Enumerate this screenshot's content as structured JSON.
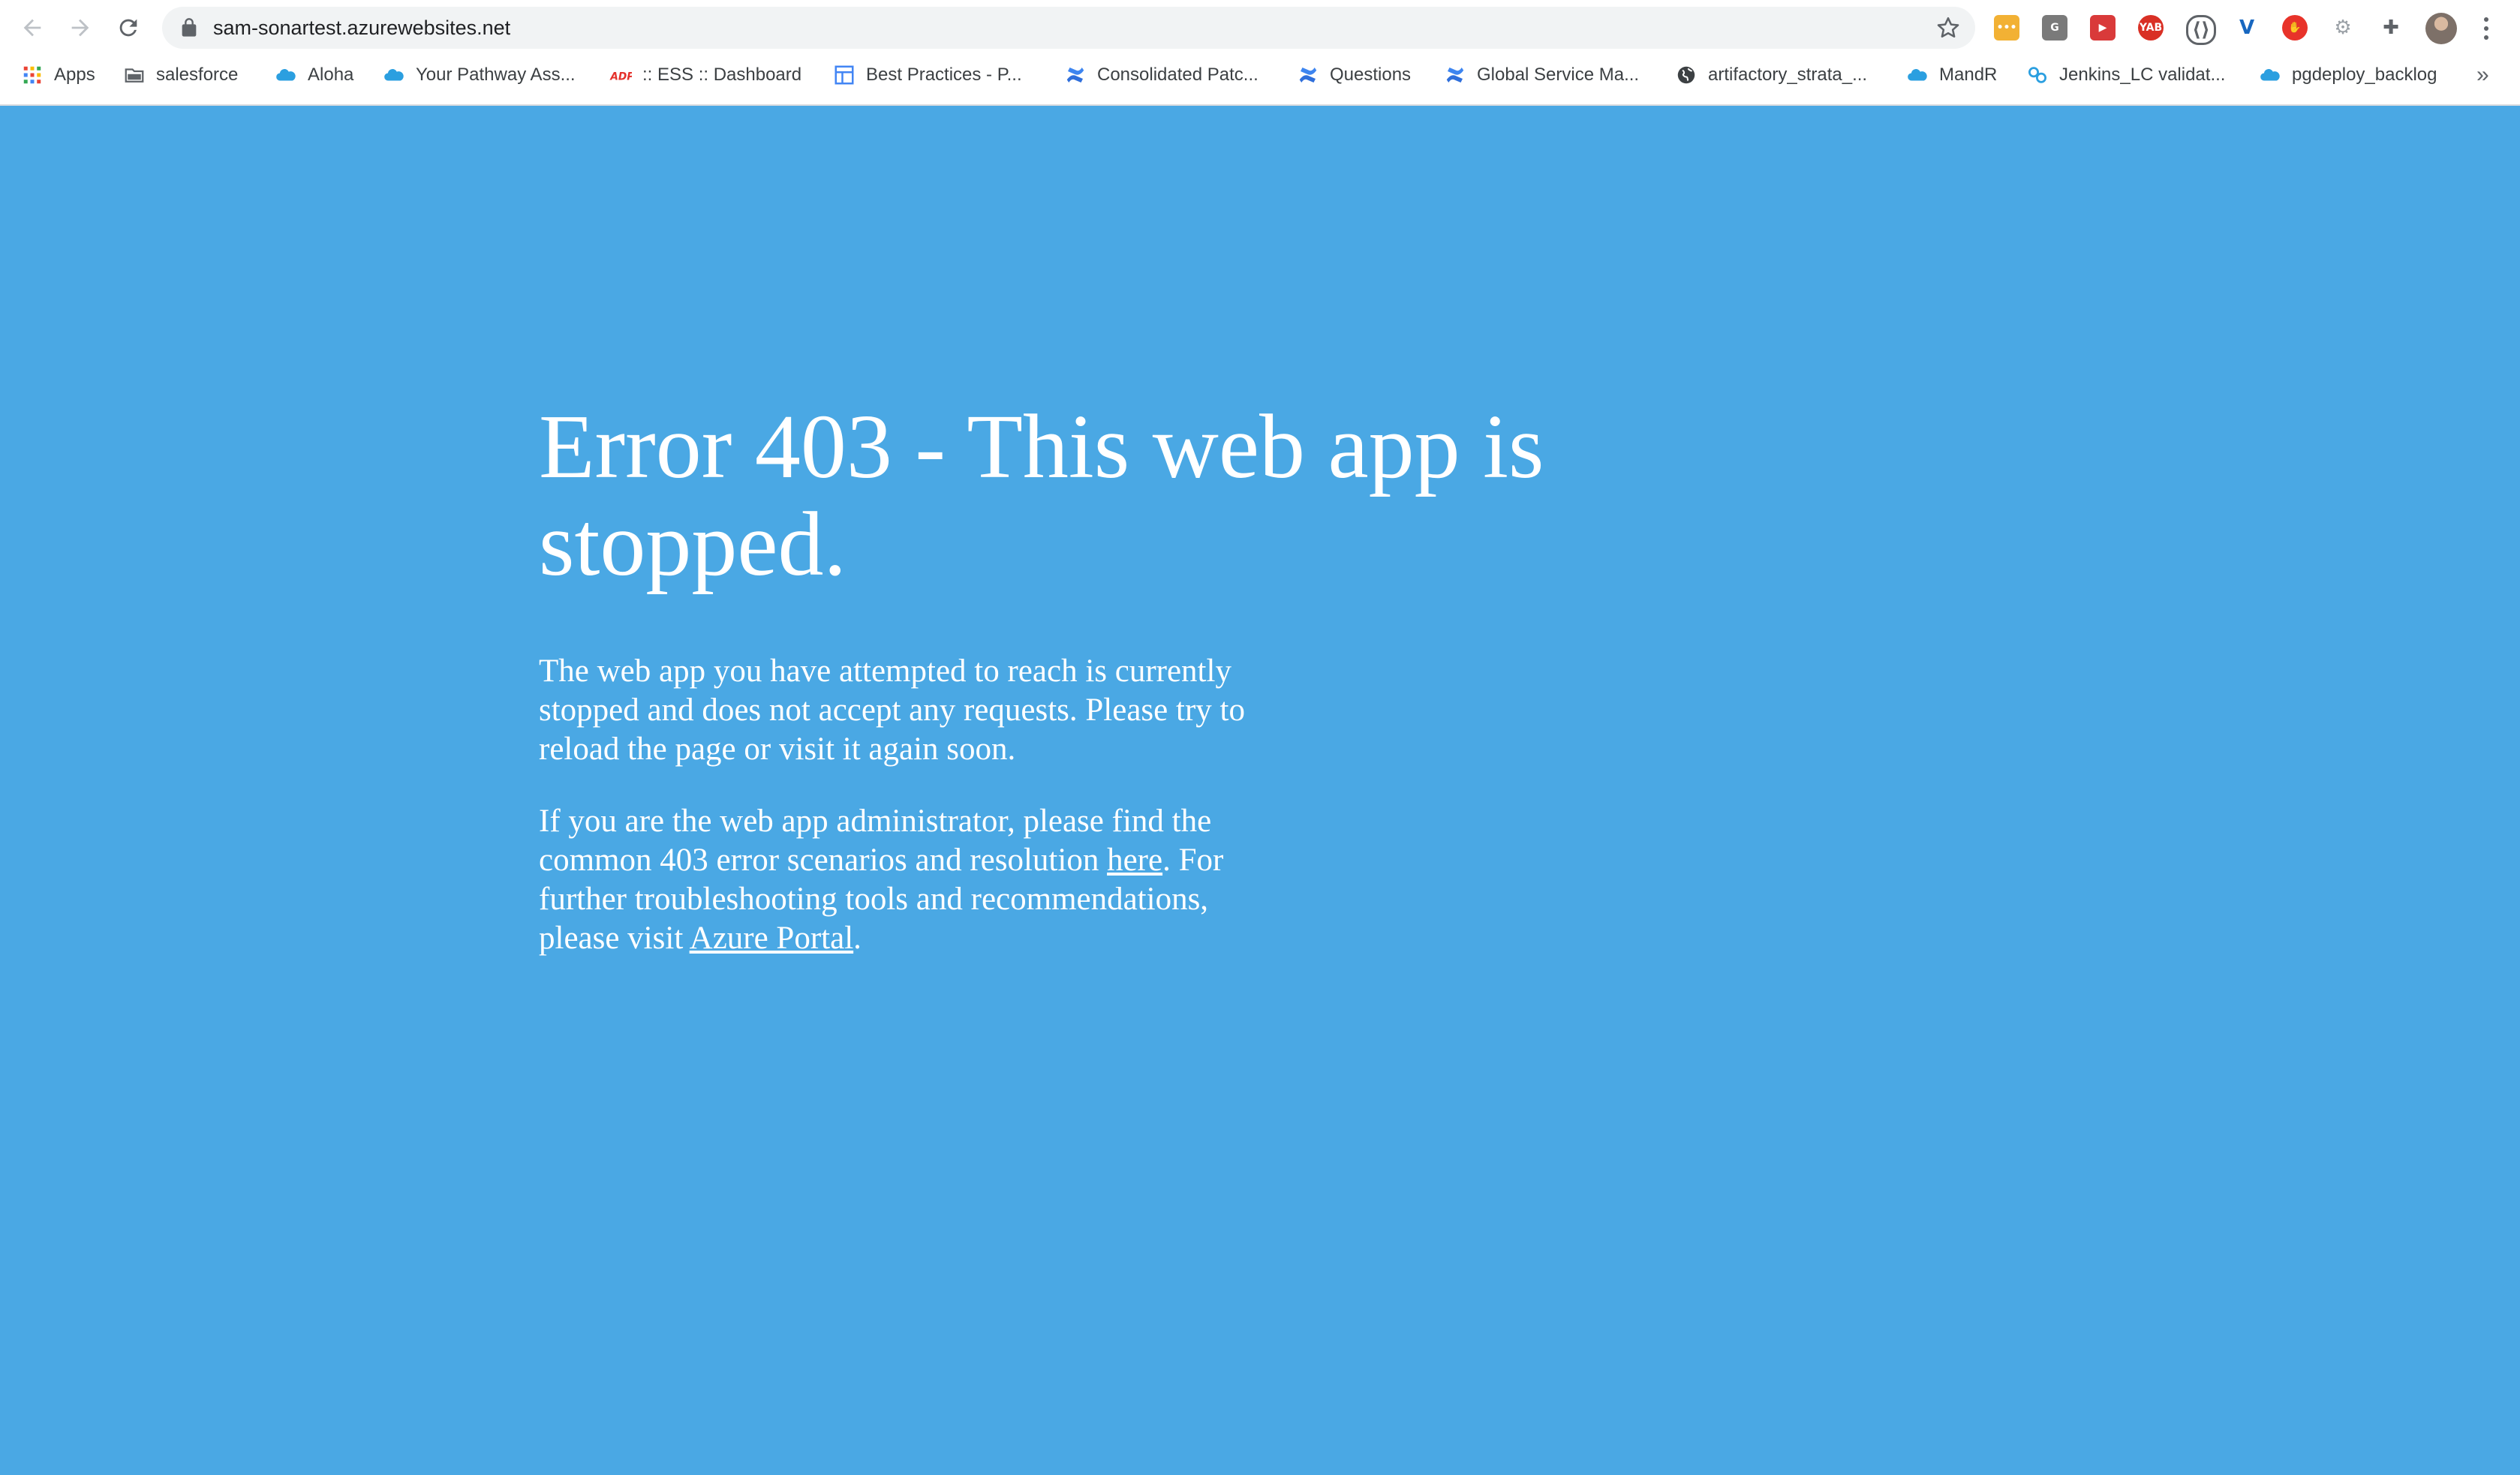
{
  "browser": {
    "url": "sam-sonartest.azurewebsites.net",
    "bookmarks": [
      {
        "label": "Apps",
        "icon": "apps-grid-icon"
      },
      {
        "label": "salesforce",
        "icon": "folder-icon"
      },
      {
        "label": "Aloha",
        "icon": "salesforce-cloud-icon"
      },
      {
        "label": "Your Pathway Ass...",
        "icon": "salesforce-cloud-icon"
      },
      {
        "label": ":: ESS :: Dashboard",
        "icon": "adp-icon"
      },
      {
        "label": "Best Practices - P...",
        "icon": "table-icon"
      },
      {
        "label": "Consolidated Patc...",
        "icon": "confluence-icon"
      },
      {
        "label": "Questions",
        "icon": "confluence-icon"
      },
      {
        "label": "Global Service Ma...",
        "icon": "confluence-icon"
      },
      {
        "label": "artifactory_strata_...",
        "icon": "globe-icon"
      },
      {
        "label": "MandR",
        "icon": "salesforce-cloud-icon"
      },
      {
        "label": "Jenkins_LC validat...",
        "icon": "link-icon"
      },
      {
        "label": "pgdeploy_backlog",
        "icon": "salesforce-cloud-icon"
      }
    ],
    "more_label": "»",
    "extensions": [
      {
        "name": "dots-extension-icon",
        "text": "•••",
        "color": "#f2b134"
      },
      {
        "name": "grammarly-extension-icon",
        "text": "G",
        "color": "#7a7a7a"
      },
      {
        "name": "play-extension-icon",
        "text": "▶",
        "color": "#d93a3a"
      },
      {
        "name": "yab-extension-icon",
        "text": "YAB",
        "color": "#d93025"
      },
      {
        "name": "code-extension-icon",
        "text": "⟨⟩",
        "color": "#5f6368"
      },
      {
        "name": "vuetify-extension-icon",
        "text": "V",
        "color": "#1867c0"
      },
      {
        "name": "adblock-extension-icon",
        "text": "✋",
        "color": "#e8332a"
      },
      {
        "name": "settings-extension-icon",
        "text": "⚙",
        "color": "#9aa0a6"
      },
      {
        "name": "puzzle-extension-icon",
        "text": "✚",
        "color": "#5f6368"
      }
    ]
  },
  "error_page": {
    "heading": "Error 403 - This web app is stopped.",
    "paragraph1": "The web app you have attempted to reach is currently stopped and does not accept any requests. Please try to reload the page or visit it again soon.",
    "paragraph2_part1": "If you are the web app administrator, please find the common 403 error scenarios and resolution ",
    "link_here": "here",
    "paragraph2_part2": ". For further troubleshooting tools and recommendations, please visit ",
    "link_azure_portal": "Azure Portal",
    "paragraph2_part3": "."
  },
  "colors": {
    "page_background": "#4aa8e4",
    "text": "#ffffff"
  }
}
